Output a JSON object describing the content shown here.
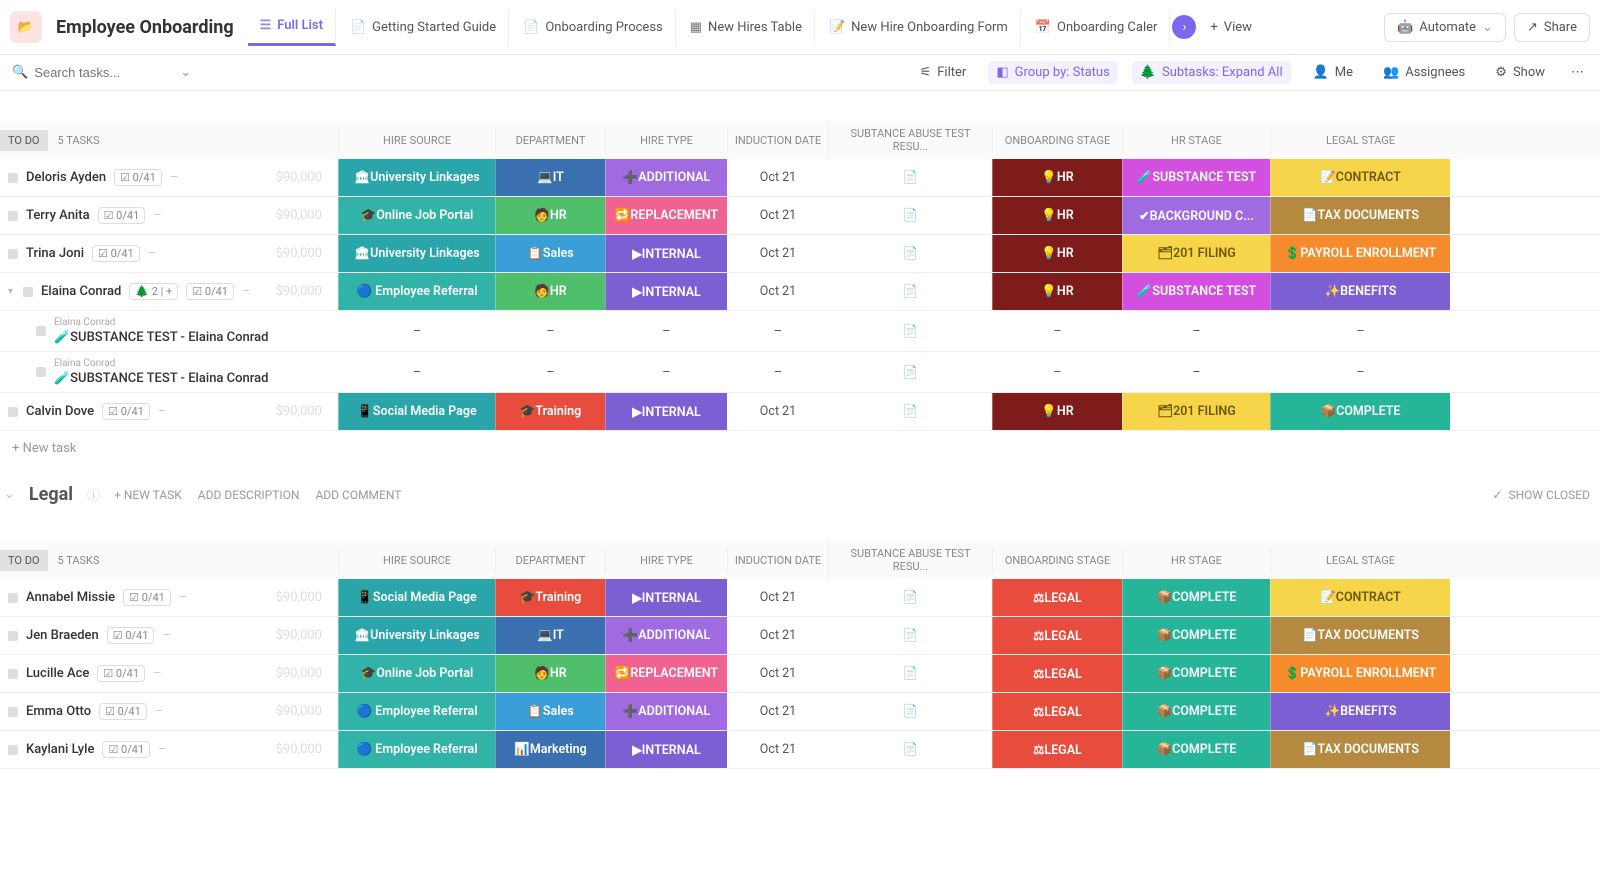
{
  "header": {
    "title": "Employee Onboarding",
    "tabs": [
      "Full List",
      "Getting Started Guide",
      "Onboarding Process",
      "New Hires Table",
      "New Hire Onboarding Form",
      "Onboarding Caler"
    ],
    "view": "View",
    "automate": "Automate",
    "share": "Share"
  },
  "toolbar": {
    "search_placeholder": "Search tasks...",
    "filter": "Filter",
    "group_by": "Group by: Status",
    "subtasks": "Subtasks: Expand All",
    "me": "Me",
    "assignees": "Assignees",
    "show": "Show"
  },
  "columns": [
    "HIRE SOURCE",
    "DEPARTMENT",
    "HIRE TYPE",
    "INDUCTION DATE",
    "SUBTANCE ABUSE TEST RESU...",
    "ONBOARDING STAGE",
    "HR STAGE",
    "LEGAL STAGE"
  ],
  "taskcount": "5 TASKS",
  "todo": "TO DO",
  "newtask": "+ New task",
  "amount": "$90,000",
  "groups": {
    "legal": {
      "name": "Legal",
      "newtask": "+ NEW TASK",
      "adddesc": "ADD DESCRIPTION",
      "addcomment": "ADD COMMENT",
      "showclosed": "SHOW CLOSED"
    }
  },
  "rows1": [
    {
      "name": "Deloris Ayden",
      "sub": "0/41",
      "hiresrc": "🏛University Linkages",
      "hiresrc_c": "c-tealA",
      "dept": "💻IT",
      "dept_c": "c-blue",
      "htype": "➕ADDITIONAL",
      "htype_c": "c-violet",
      "induct": "Oct 21",
      "ob": "💡HR",
      "ob_c": "c-darkred",
      "hr": "🧪SUBSTANCE TEST",
      "hr_c": "c-magenta",
      "legal": "📝CONTRACT",
      "legal_c": "c-yellow"
    },
    {
      "name": "Terry Anita",
      "sub": "0/41",
      "hiresrc": "🎓Online Job Portal",
      "hiresrc_c": "c-tealB",
      "dept": "🧑HR",
      "dept_c": "c-green",
      "htype": "🔁REPLACEMENT",
      "htype_c": "c-pink",
      "induct": "Oct 21",
      "ob": "💡HR",
      "ob_c": "c-darkred",
      "hr": "✔BACKGROUND C...",
      "hr_c": "c-violet",
      "legal": "📄TAX DOCUMENTS",
      "legal_c": "c-brown"
    },
    {
      "name": "Trina Joni",
      "sub": "0/41",
      "hiresrc": "🏛University Linkages",
      "hiresrc_c": "c-tealA",
      "dept": "📋Sales",
      "dept_c": "c-ltblue",
      "htype": "▶INTERNAL",
      "htype_c": "c-purple",
      "induct": "Oct 21",
      "ob": "💡HR",
      "ob_c": "c-darkred",
      "hr": "🗂201 FILING",
      "hr_c": "c-yellow",
      "legal": "💲PAYROLL ENROLLMENT",
      "legal_c": "c-orange"
    },
    {
      "name": "Elaina Conrad",
      "sub": "0/41",
      "subcount": "2",
      "hiresrc": "🔵 Employee Referral",
      "hiresrc_c": "c-tealB",
      "dept": "🧑HR",
      "dept_c": "c-green",
      "htype": "▶INTERNAL",
      "htype_c": "c-purple",
      "induct": "Oct 21",
      "ob": "💡HR",
      "ob_c": "c-darkred",
      "hr": "🧪SUBSTANCE TEST",
      "hr_c": "c-magenta",
      "legal": "✨BENEFITS",
      "legal_c": "c-purple",
      "expanded": true
    },
    {
      "subtask": true,
      "parent": "Elaina Conrad",
      "name": "🧪SUBSTANCE TEST - Elaina Conrad"
    },
    {
      "subtask": true,
      "parent": "Elaina Conrad",
      "name": "🧪SUBSTANCE TEST - Elaina Conrad"
    },
    {
      "name": "Calvin Dove",
      "sub": "0/41",
      "hiresrc": "📱Social Media Page",
      "hiresrc_c": "c-tealA",
      "dept": "🎓Training",
      "dept_c": "c-red",
      "htype": "▶INTERNAL",
      "htype_c": "c-purple",
      "induct": "Oct 21",
      "ob": "💡HR",
      "ob_c": "c-darkred",
      "hr": "🗂201 FILING",
      "hr_c": "c-yellow",
      "legal": "📦COMPLETE",
      "legal_c": "c-teal2"
    }
  ],
  "rows2": [
    {
      "name": "Annabel Missie",
      "sub": "0/41",
      "hiresrc": "📱Social Media Page",
      "hiresrc_c": "c-tealA",
      "dept": "🎓Training",
      "dept_c": "c-red",
      "htype": "▶INTERNAL",
      "htype_c": "c-purple",
      "induct": "Oct 21",
      "ob": "⚖LEGAL",
      "ob_c": "c-red",
      "hr": "📦COMPLETE",
      "hr_c": "c-teal2",
      "legal": "📝CONTRACT",
      "legal_c": "c-yellow"
    },
    {
      "name": "Jen Braeden",
      "sub": "0/41",
      "hiresrc": "🏛University Linkages",
      "hiresrc_c": "c-tealA",
      "dept": "💻IT",
      "dept_c": "c-blue",
      "htype": "➕ADDITIONAL",
      "htype_c": "c-violet",
      "induct": "Oct 21",
      "ob": "⚖LEGAL",
      "ob_c": "c-red",
      "hr": "📦COMPLETE",
      "hr_c": "c-teal2",
      "legal": "📄TAX DOCUMENTS",
      "legal_c": "c-brown"
    },
    {
      "name": "Lucille Ace",
      "sub": "0/41",
      "hiresrc": "🎓Online Job Portal",
      "hiresrc_c": "c-tealB",
      "dept": "🧑HR",
      "dept_c": "c-green",
      "htype": "🔁REPLACEMENT",
      "htype_c": "c-pink",
      "induct": "Oct 21",
      "ob": "⚖LEGAL",
      "ob_c": "c-red",
      "hr": "📦COMPLETE",
      "hr_c": "c-teal2",
      "legal": "💲PAYROLL ENROLLMENT",
      "legal_c": "c-orange"
    },
    {
      "name": "Emma Otto",
      "sub": "0/41",
      "hiresrc": "🔵 Employee Referral",
      "hiresrc_c": "c-tealB",
      "dept": "📋Sales",
      "dept_c": "c-ltblue",
      "htype": "➕ADDITIONAL",
      "htype_c": "c-violet",
      "induct": "Oct 21",
      "ob": "⚖LEGAL",
      "ob_c": "c-red",
      "hr": "📦COMPLETE",
      "hr_c": "c-teal2",
      "legal": "✨BENEFITS",
      "legal_c": "c-purple"
    },
    {
      "name": "Kaylani Lyle",
      "sub": "0/41",
      "hiresrc": "🔵 Employee Referral",
      "hiresrc_c": "c-tealB",
      "dept": "📊Marketing",
      "dept_c": "c-blue",
      "htype": "▶INTERNAL",
      "htype_c": "c-purple",
      "induct": "Oct 21",
      "ob": "⚖LEGAL",
      "ob_c": "c-red",
      "hr": "📦COMPLETE",
      "hr_c": "c-teal2",
      "legal": "📄TAX DOCUMENTS",
      "legal_c": "c-brown"
    }
  ]
}
